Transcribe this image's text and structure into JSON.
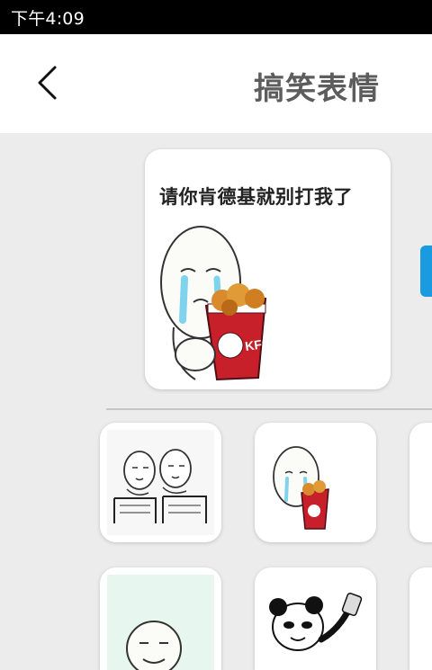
{
  "status_bar": {
    "time": "下午4:09"
  },
  "header": {
    "title": "搞笑表情",
    "back_icon": "chevron-left-icon"
  },
  "featured": {
    "caption": "请你肯德基就别打我了"
  },
  "colors": {
    "accent_tab": "#1a9be0",
    "title": "#5d5d5d",
    "status_bar": "#000000",
    "background": "#ececec"
  },
  "grid": {
    "items": [
      {
        "image": "two-meme-faces-at-desks"
      },
      {
        "image": "crying-meme-face-with-bucket"
      },
      {
        "image": "partially-visible-sticker"
      },
      {
        "image": "smiling-meme-face"
      },
      {
        "image": "panda-meme-holding-phone"
      },
      {
        "image": "partially-visible-sticker"
      }
    ]
  }
}
